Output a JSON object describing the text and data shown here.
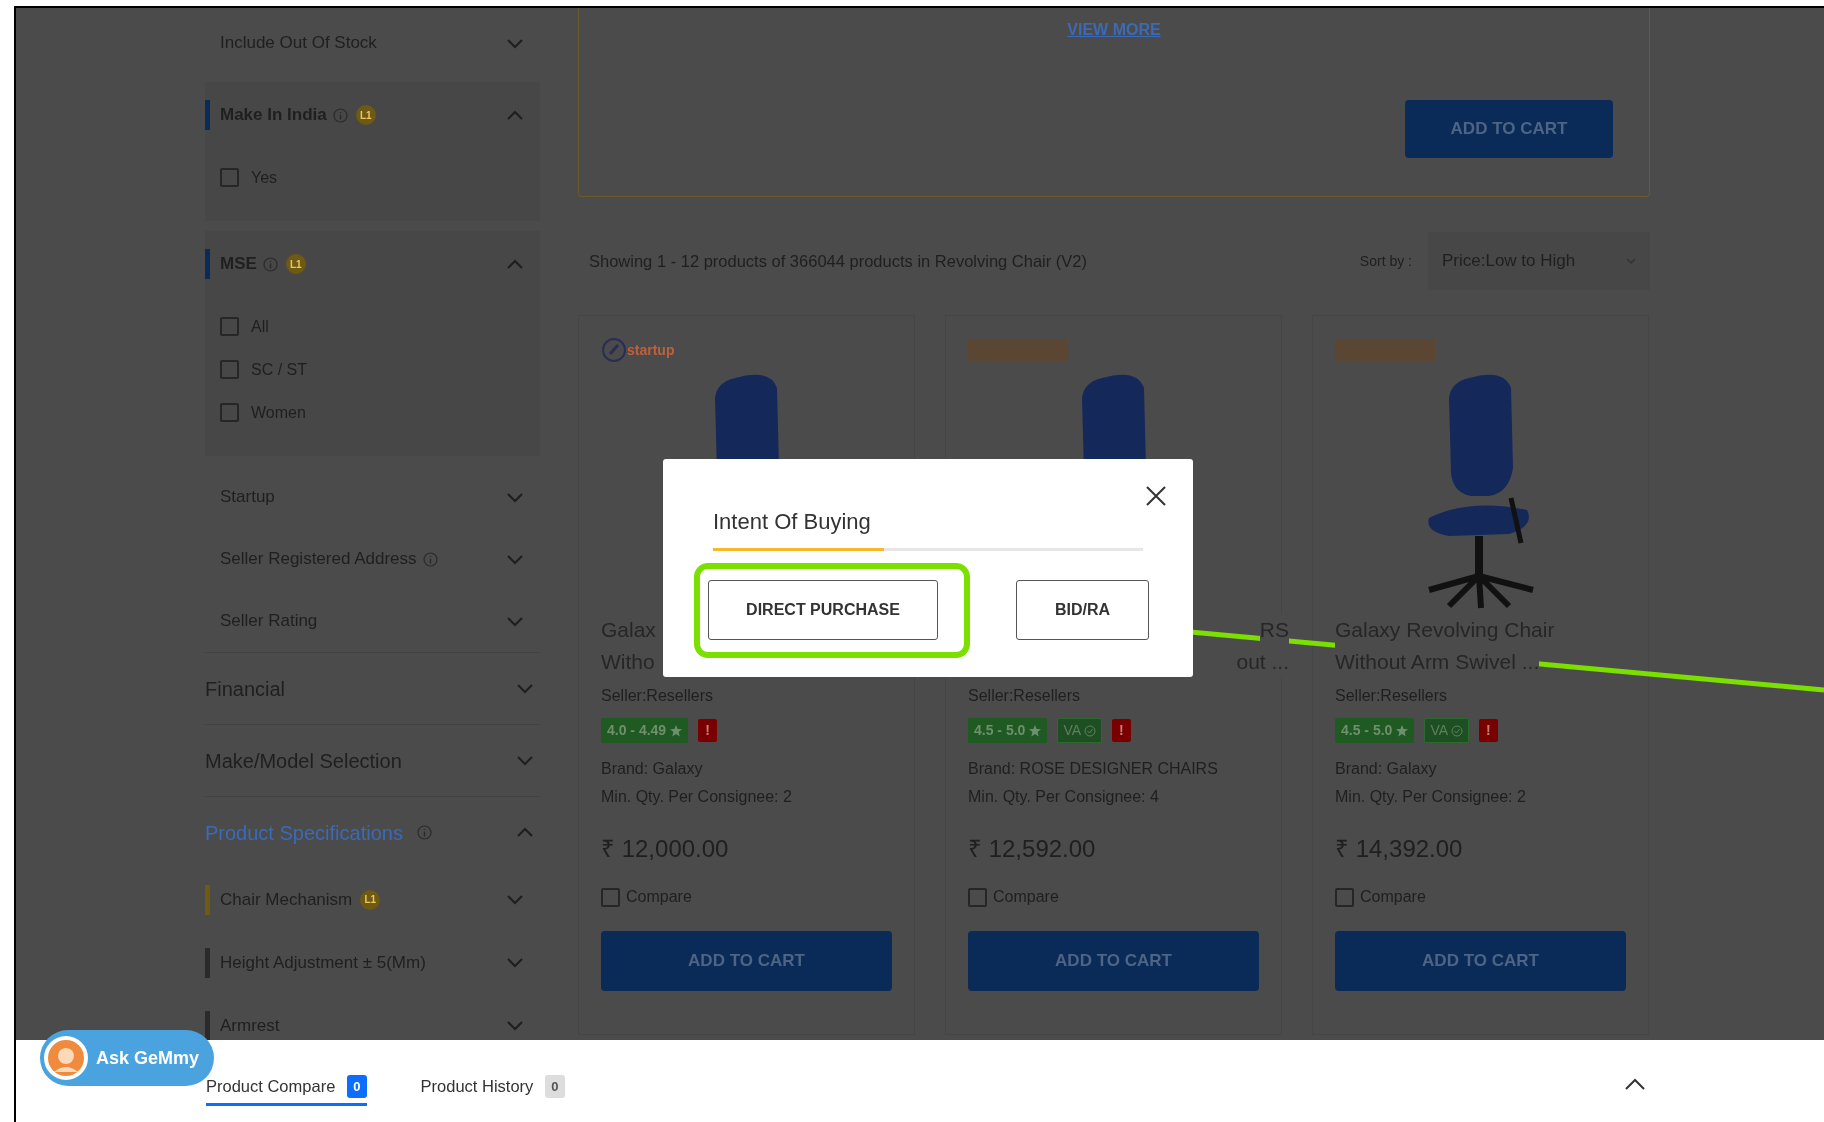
{
  "filters": [
    {
      "kind": "plain",
      "label": "Include Out Of Stock",
      "expanded": false
    },
    {
      "kind": "panel",
      "label": "Make In India",
      "info": true,
      "badge": "L1",
      "expanded": true,
      "options": [
        {
          "label": "Yes",
          "checked": false
        }
      ]
    },
    {
      "kind": "panel",
      "label": "MSE",
      "info": true,
      "badge": "L1",
      "expanded": true,
      "options": [
        {
          "label": "All",
          "checked": false
        },
        {
          "label": "SC / ST",
          "checked": false
        },
        {
          "label": "Women",
          "checked": false
        }
      ]
    },
    {
      "kind": "plain",
      "label": "Startup",
      "expanded": false
    },
    {
      "kind": "plain",
      "label": "Seller Registered Address",
      "info": true,
      "expanded": false
    },
    {
      "kind": "plain",
      "label": "Seller Rating",
      "expanded": false
    },
    {
      "kind": "heading",
      "label": "Financial",
      "expanded": false,
      "highlighted": false
    },
    {
      "kind": "heading",
      "label": "Make/Model Selection",
      "expanded": false,
      "highlighted": false
    },
    {
      "kind": "heading",
      "label": "Product Specifications",
      "info": true,
      "expanded": true,
      "highlighted": true
    },
    {
      "kind": "spec",
      "label": "Chair Mechanism",
      "badge": "L1",
      "color": "#6e5a12",
      "expanded": false
    },
    {
      "kind": "spec",
      "label": "Height Adjustment ± 5(Mm)",
      "color": "#2a2a2a",
      "expanded": false
    },
    {
      "kind": "spec",
      "label": "Armrest",
      "color": "#2a2a2a",
      "expanded": false
    }
  ],
  "featured": {
    "view_more": "VIEW MORE",
    "button": "ADD TO CART"
  },
  "results": {
    "summary": "Showing 1 - 12 products of 366044 products in Revolving Chair (V2)",
    "sort_label": "Sort by :",
    "sort_value": "Price:Low to High"
  },
  "products": [
    {
      "logo": {
        "kind": "startup",
        "text": "startup"
      },
      "title_lines": [
        "Galax",
        "Witho"
      ],
      "seller": "Seller:Resellers",
      "rating": "4.0 - 4.49",
      "alert": "!",
      "brand": "Brand: Galaxy",
      "min_qty": "Min. Qty. Per Consignee: 2",
      "price": "₹ 12,000.00",
      "compare": {
        "label": "Compare",
        "checked": false
      },
      "button": "ADD TO CART"
    },
    {
      "logo": {
        "kind": "image"
      },
      "title_lines": [
        "RS",
        "out ..."
      ],
      "seller": "Seller:Resellers",
      "rating": "4.5 - 5.0",
      "va": "VA",
      "alert": "!",
      "brand": "Brand: ROSE DESIGNER CHAIRS",
      "min_qty": "Min. Qty. Per Consignee: 4",
      "price": "₹ 12,592.00",
      "compare": {
        "label": "Compare",
        "checked": false
      },
      "button": "ADD TO CART"
    },
    {
      "logo": {
        "kind": "image"
      },
      "title_lines": [
        "Galaxy Revolving Chair",
        "Without Arm Swivel ..."
      ],
      "seller": "Seller:Resellers",
      "rating": "4.5 - 5.0",
      "va": "VA",
      "alert": "!",
      "brand": "Brand: Galaxy",
      "min_qty": "Min. Qty. Per Consignee: 2",
      "price": "₹ 14,392.00",
      "compare": {
        "label": "Compare",
        "checked": false
      },
      "button": "ADD TO CART"
    }
  ],
  "modal": {
    "title": "Intent Of Buying",
    "buttons": [
      {
        "label": "DIRECT PURCHASE",
        "highlighted": true
      },
      {
        "label": "BID/RA",
        "highlighted": false
      }
    ]
  },
  "bottom_bar": {
    "assistant": "Ask GeMmy",
    "tabs": [
      {
        "label": "Product Compare",
        "count": "0",
        "selected": true
      },
      {
        "label": "Product History",
        "count": "0",
        "selected": false
      }
    ],
    "expanded": false
  }
}
